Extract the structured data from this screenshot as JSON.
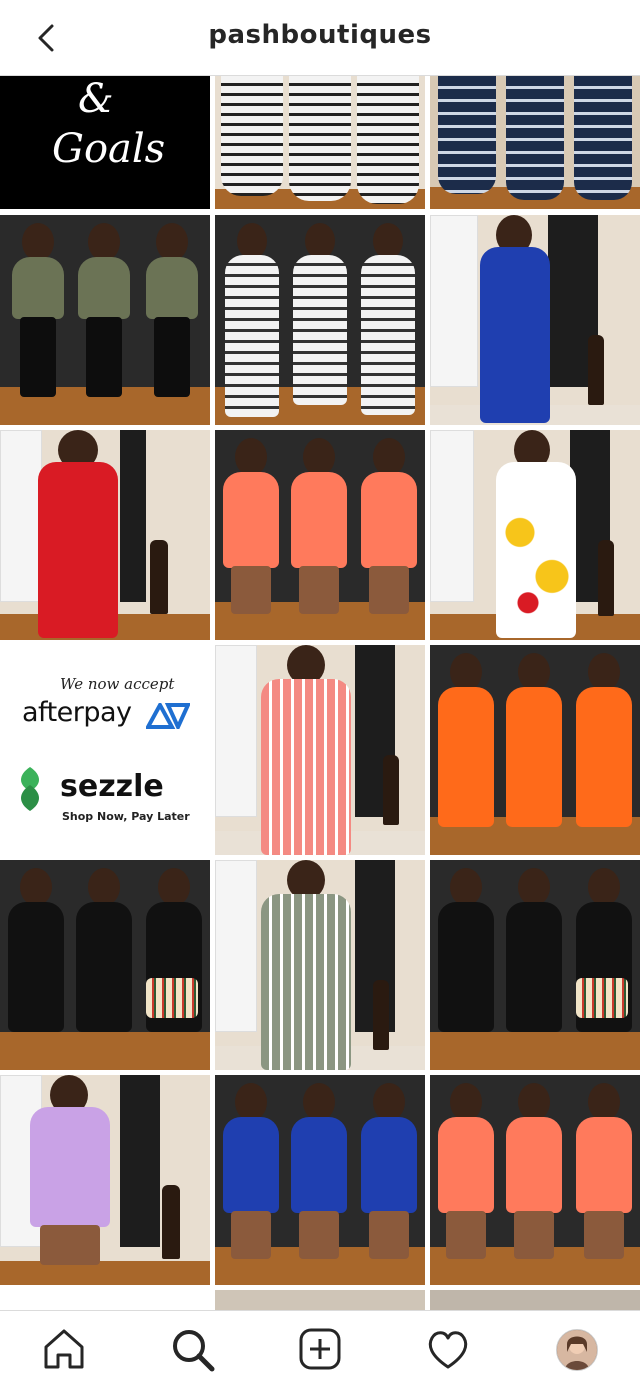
{
  "header": {
    "title": "pashboutiques",
    "back_icon": "chevron-left-icon"
  },
  "tiles": {
    "goals": {
      "ampersand": "&",
      "text": "Goals"
    },
    "payments": {
      "tagline": "We now accept",
      "afterpay": "afterpay",
      "sezzle": "sezzle",
      "sezzle_sub": "Shop Now, Pay Later"
    }
  },
  "bottom_nav": {
    "items": [
      "home-icon",
      "search-icon",
      "new-post-icon",
      "heart-icon",
      "profile-avatar"
    ]
  },
  "colors": {
    "floor": "#a8672b",
    "wall": "#e8ded0",
    "dark": "#1d1d1d",
    "black_top": "#111111",
    "olive": "#6b7355",
    "stripe_white": "#f3f3f3",
    "stripe_navy": "#1c2c4a",
    "blue": "#1f3fb0",
    "red": "#d91b24",
    "coral": "#ff7a5c",
    "pink_stripe": "#f48a83",
    "orange": "#ff6a1a",
    "sage_stripe": "#8b9682",
    "lilac": "#c9a2e6",
    "afterpay_teal": "#1f6fd1",
    "sezzle_green": "#3bb25a"
  }
}
